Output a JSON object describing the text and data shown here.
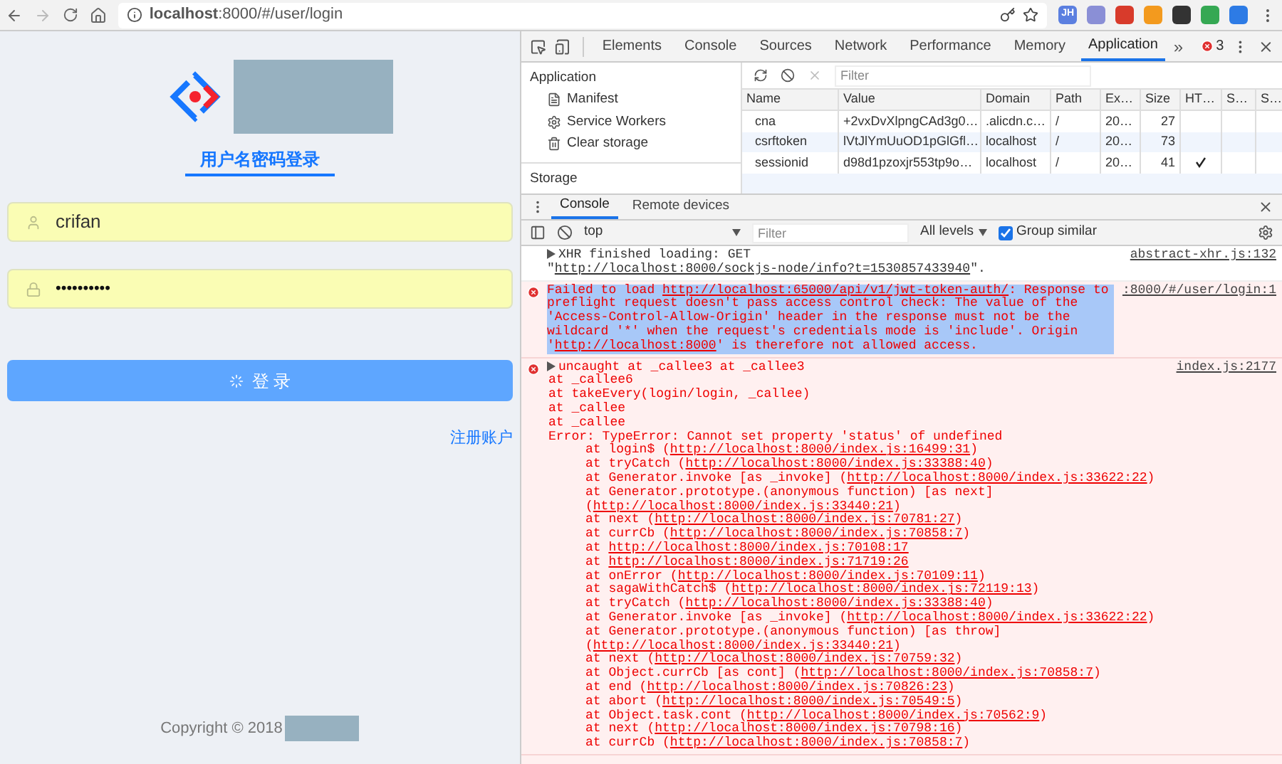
{
  "browser": {
    "url": "**localhost**:8000/#/user/login",
    "extensions": [
      {
        "label": "JH",
        "color": "#5b7fe0"
      },
      {
        "color": "#8a8fd6"
      },
      {
        "color": "#d83b2b"
      },
      {
        "color": "#f39a1e"
      },
      {
        "color": "#333333"
      },
      {
        "color": "#35a853"
      },
      {
        "color": "#2d7be5"
      }
    ]
  },
  "login_page": {
    "tab": {
      "label": "用户名密码登录",
      "selected": true
    },
    "username": {
      "value": "crifan"
    },
    "password": {
      "value": "••••••••••"
    },
    "submit": {
      "label": "登 录",
      "loading": true
    },
    "register_link": "注册账户",
    "copyright": "Copyright © 2018"
  },
  "devtools": {
    "tabs": [
      {
        "label": "Elements",
        "selected": false
      },
      {
        "label": "Console",
        "selected": false
      },
      {
        "label": "Sources",
        "selected": false
      },
      {
        "label": "Network",
        "selected": false
      },
      {
        "label": "Performance",
        "selected": false
      },
      {
        "label": "Memory",
        "selected": false
      },
      {
        "label": "Application",
        "selected": true
      }
    ],
    "more": "»",
    "error_count": "3",
    "sidebar": {
      "section": "Application",
      "items": [
        {
          "label": "Manifest",
          "kind": "file"
        },
        {
          "label": "Service Workers",
          "kind": "gear"
        },
        {
          "label": "Clear storage",
          "kind": "trash"
        }
      ],
      "section_2": "Storage"
    },
    "cookies": {
      "filter_placeholder": "Filter",
      "columns": [
        "Name",
        "Value",
        "Domain",
        "Path",
        "Ex…",
        "Size",
        "HT…",
        "S…",
        "S…"
      ],
      "rows": [
        {
          "cells": [
            "cna",
            "+2vxDvXlpngCAd3g0…",
            ".alicdn.c…",
            "/",
            "20…",
            "27"
          ],
          "http_only": false
        },
        {
          "cells": [
            "csrftoken",
            "lVtJlYmUuOD1pGlGfl…",
            "localhost",
            "/",
            "20…",
            "73"
          ],
          "http_only": false
        },
        {
          "cells": [
            "sessionid",
            "d98d1pzoxjr553tp9o…",
            "localhost",
            "/",
            "20…",
            "41"
          ],
          "http_only": true
        }
      ]
    },
    "drawer": {
      "tabs": [
        {
          "label": "Console",
          "selected": true
        },
        {
          "label": "Remote devices",
          "selected": false
        }
      ],
      "context": "top",
      "filter_placeholder": "Filter",
      "levels": "All levels",
      "group_similar": {
        "label": "Group similar",
        "checked": true
      },
      "messages": [
        {
          "kind": "log",
          "source": "abstract-xhr.js:132",
          "selected": false,
          "parts": [
            {
              "text": "XHR finished loading: GET \""
            },
            {
              "link": "http://localhost:8000/sockjs-node/info?t=1530857433940"
            },
            {
              "text": "\"."
            }
          ]
        },
        {
          "kind": "error",
          "source": ":8000/#/user/login:1",
          "selected": true,
          "parts": [
            {
              "text": "Failed to load "
            },
            {
              "link": "http://localhost:65000/api/v1/jwt-token-auth/"
            },
            {
              "text": ": Response to preflight request doesn't pass access control check: The value of the 'Access-Control-Allow-Origin' header in the response must not be the wildcard '*' when the request's credentials mode is 'include'. Origin '"
            },
            {
              "link": "http://localhost:8000"
            },
            {
              "text": "' is therefore not allowed access."
            }
          ]
        },
        {
          "kind": "error",
          "source": "index.js:2177",
          "selected": false,
          "expandable": true,
          "parts": [
            {
              "text": "uncaught at _callee3 at _callee3"
            }
          ],
          "stack": [
            {
              "kind": "plain",
              "text": "at _callee6"
            },
            {
              "kind": "plain",
              "text": "at takeEvery(login/login, _callee)"
            },
            {
              "kind": "plain",
              "text": "at _callee"
            },
            {
              "kind": "plain",
              "text": "at _callee"
            },
            {
              "kind": "plain",
              "text": "Error: TypeError: Cannot set property 'status' of undefined"
            },
            {
              "kind": "frame",
              "prefix": "at login$ (",
              "link": "http://localhost:8000/index.js:16499:31",
              "suffix": ")"
            },
            {
              "kind": "frame",
              "prefix": "at tryCatch (",
              "link": "http://localhost:8000/index.js:33388:40",
              "suffix": ")"
            },
            {
              "kind": "frame",
              "prefix": "at Generator.invoke [as _invoke] (",
              "link": "http://localhost:8000/index.js:33622:22",
              "suffix": ")"
            },
            {
              "kind": "frame",
              "prefix": "at Generator.prototype.(anonymous function) [as next] (",
              "link": "http://localhost:8000/index.js:33440:21",
              "suffix": ")"
            },
            {
              "kind": "frame",
              "prefix": "at next (",
              "link": "http://localhost:8000/index.js:70781:27",
              "suffix": ")"
            },
            {
              "kind": "frame",
              "prefix": "at currCb (",
              "link": "http://localhost:8000/index.js:70858:7",
              "suffix": ")"
            },
            {
              "kind": "frame",
              "prefix": "at ",
              "link": "http://localhost:8000/index.js:70108:17"
            },
            {
              "kind": "frame",
              "prefix": "at ",
              "link": "http://localhost:8000/index.js:71719:26"
            },
            {
              "kind": "frame",
              "prefix": "at onError (",
              "link": "http://localhost:8000/index.js:70109:11",
              "suffix": ")"
            },
            {
              "kind": "frame",
              "prefix": "at sagaWithCatch$ (",
              "link": "http://localhost:8000/index.js:72119:13",
              "suffix": ")"
            },
            {
              "kind": "frame",
              "prefix": "at tryCatch (",
              "link": "http://localhost:8000/index.js:33388:40",
              "suffix": ")"
            },
            {
              "kind": "frame",
              "prefix": "at Generator.invoke [as _invoke] (",
              "link": "http://localhost:8000/index.js:33622:22",
              "suffix": ")"
            },
            {
              "kind": "frame",
              "prefix": "at Generator.prototype.(anonymous function) [as throw] (",
              "link": "http://localhost:8000/index.js:33440:21",
              "suffix": ")"
            },
            {
              "kind": "frame",
              "prefix": "at next (",
              "link": "http://localhost:8000/index.js:70759:32",
              "suffix": ")"
            },
            {
              "kind": "frame",
              "prefix": "at Object.currCb [as cont] (",
              "link": "http://localhost:8000/index.js:70858:7",
              "suffix": ")"
            },
            {
              "kind": "frame",
              "prefix": "at end (",
              "link": "http://localhost:8000/index.js:70826:23",
              "suffix": ")"
            },
            {
              "kind": "frame",
              "prefix": "at abort (",
              "link": "http://localhost:8000/index.js:70549:5",
              "suffix": ")"
            },
            {
              "kind": "frame",
              "prefix": "at Object.task.cont (",
              "link": "http://localhost:8000/index.js:70562:9",
              "suffix": ")"
            },
            {
              "kind": "frame",
              "prefix": "at next (",
              "link": "http://localhost:8000/index.js:70798:16",
              "suffix": ")"
            },
            {
              "kind": "frame",
              "prefix": "at currCb (",
              "link": "http://localhost:8000/index.js:70858:7",
              "suffix": ")"
            }
          ]
        }
      ]
    }
  }
}
